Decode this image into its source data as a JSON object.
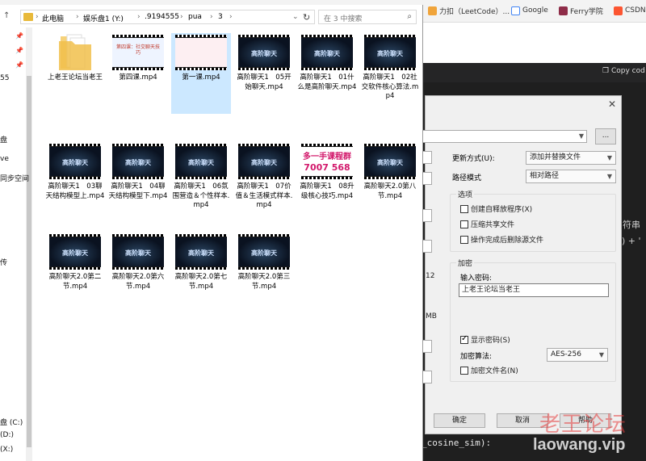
{
  "browser": {
    "bookmarks": [
      {
        "label": "力扣（LeetCode）...",
        "icon": "leetcode-icon",
        "color": "#f0a43a"
      },
      {
        "label": "Google",
        "icon": "google-icon",
        "color": "#4285f4"
      },
      {
        "label": "Ferry学院",
        "icon": "ferry-icon",
        "color": "#8e2c48"
      },
      {
        "label": "CSDN",
        "icon": "csdn-icon",
        "color": "#fc5531"
      }
    ]
  },
  "editor": {
    "copy_label": "Copy cod",
    "code_tail": "_cosine_sim):",
    "fragment_a": "符串",
    "fragment_b": ") + '"
  },
  "watermark": {
    "cn": "老王论坛",
    "url": "laowang.vip"
  },
  "explorer": {
    "breadcrumb": [
      "此电脑",
      "娱乐盘1 (Y:)",
      ".9194555",
      "pua",
      "3"
    ],
    "search_placeholder": "在 3 中搜索",
    "nav_labels": [
      "55",
      "盘",
      "ve",
      "同步空间",
      "传",
      "盘 (C:)",
      "(D:)",
      "(X:)"
    ],
    "files": [
      {
        "name": "上老王论坛当老王",
        "kind": "folder"
      },
      {
        "name": "第四课.mp4",
        "kind": "light"
      },
      {
        "name": "第一课.mp4",
        "kind": "pink",
        "selected": true
      },
      {
        "name": "高阶聊天1　05开始聊天.mp4",
        "kind": "dark"
      },
      {
        "name": "高阶聊天1　01什么是高阶聊天.mp4",
        "kind": "dark"
      },
      {
        "name": "高阶聊天1　02社交软件核心算法.mp4",
        "kind": "dark"
      },
      {
        "name": "高阶聊天1　03聊天结构模型上.mp4",
        "kind": "dark"
      },
      {
        "name": "高阶聊天1　04聊天结构模型下.mp4",
        "kind": "dark"
      },
      {
        "name": "高阶聊天1　06氛围营造＆个性样本.mp4",
        "kind": "dark"
      },
      {
        "name": "高阶聊天1　07价值＆生活模式样本.mp4",
        "kind": "dark"
      },
      {
        "name": "高阶聊天1　08升级核心技巧.mp4",
        "kind": "ad"
      },
      {
        "name": "高阶聊天2.0第八节.mp4",
        "kind": "dark"
      },
      {
        "name": "高阶聊天2.0第二节.mp4",
        "kind": "dark"
      },
      {
        "name": "高阶聊天2.0第六节.mp4",
        "kind": "dark"
      },
      {
        "name": "高阶聊天2.0第七节.mp4",
        "kind": "dark"
      },
      {
        "name": "高阶聊天2.0第三节.mp4",
        "kind": "dark"
      }
    ],
    "thumb_dark_text": "高阶聊天",
    "thumb_light_text": "第四课：社交聊天技巧",
    "thumb_ad_line1": "多一手课程群",
    "thumb_ad_line2": "7007 568"
  },
  "dialog": {
    "update_label": "更新方式(U):",
    "update_value": "添加并替换文件",
    "path_label": "路径模式",
    "path_value": "相对路径",
    "browse_label": "...",
    "options_title": "选项",
    "opt_sfx": "创建自释放程序(X)",
    "opt_shared": "压缩共享文件",
    "opt_delete": "操作完成后删除源文件",
    "encrypt_title": "加密",
    "pwd_label": "输入密码:",
    "pwd_value": "上老王论坛当老王",
    "show_pwd": "显示密码(S)",
    "algo_label": "加密算法:",
    "algo_value": "AES-256",
    "encrypt_names": "加密文件名(N)",
    "ok": "确定",
    "cancel": "取消",
    "help": "帮助",
    "side_12": "12",
    "side_mb": "MB"
  }
}
